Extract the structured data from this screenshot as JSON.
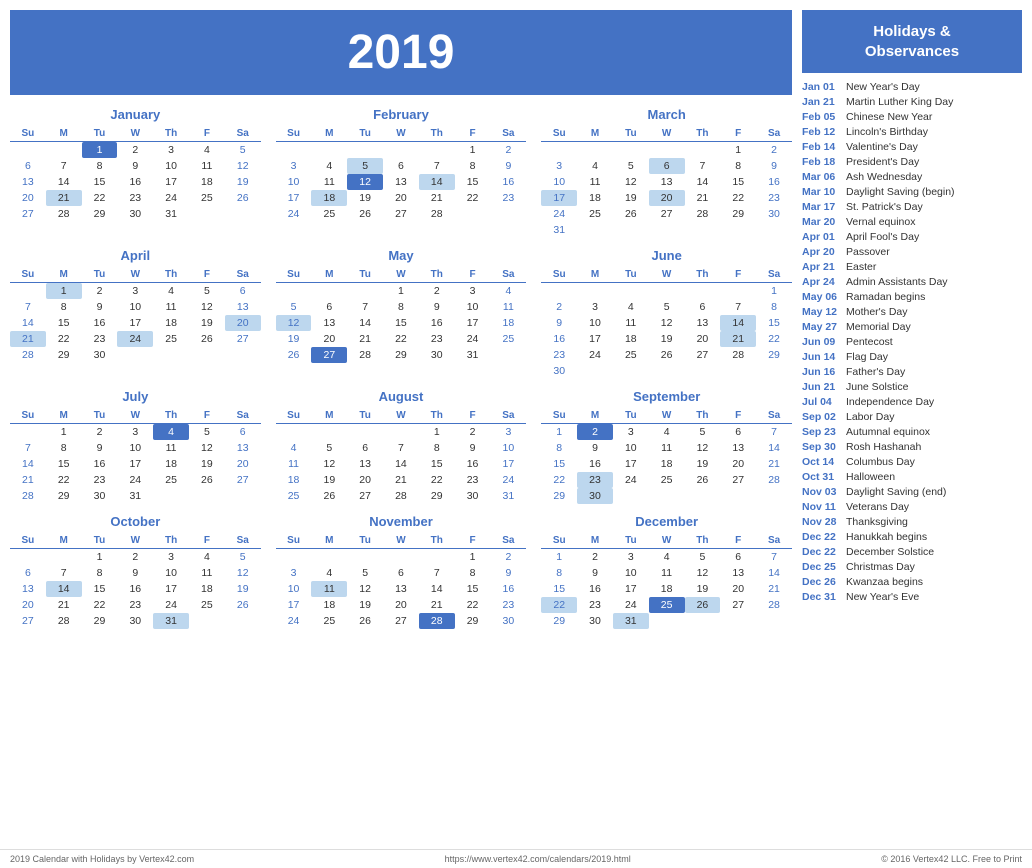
{
  "year": "2019",
  "sidebar": {
    "title": "Holidays &\nObservances",
    "holidays": [
      {
        "date": "Jan 01",
        "name": "New Year's Day"
      },
      {
        "date": "Jan 21",
        "name": "Martin Luther King Day"
      },
      {
        "date": "Feb 05",
        "name": "Chinese New Year"
      },
      {
        "date": "Feb 12",
        "name": "Lincoln's Birthday"
      },
      {
        "date": "Feb 14",
        "name": "Valentine's Day"
      },
      {
        "date": "Feb 18",
        "name": "President's Day"
      },
      {
        "date": "Mar 06",
        "name": "Ash Wednesday"
      },
      {
        "date": "Mar 10",
        "name": "Daylight Saving (begin)"
      },
      {
        "date": "Mar 17",
        "name": "St. Patrick's Day"
      },
      {
        "date": "Mar 20",
        "name": "Vernal equinox"
      },
      {
        "date": "Apr 01",
        "name": "April Fool's Day"
      },
      {
        "date": "Apr 20",
        "name": "Passover"
      },
      {
        "date": "Apr 21",
        "name": "Easter"
      },
      {
        "date": "Apr 24",
        "name": "Admin Assistants Day"
      },
      {
        "date": "May 06",
        "name": "Ramadan begins"
      },
      {
        "date": "May 12",
        "name": "Mother's Day"
      },
      {
        "date": "May 27",
        "name": "Memorial Day"
      },
      {
        "date": "Jun 09",
        "name": "Pentecost"
      },
      {
        "date": "Jun 14",
        "name": "Flag Day"
      },
      {
        "date": "Jun 16",
        "name": "Father's Day"
      },
      {
        "date": "Jun 21",
        "name": "June Solstice"
      },
      {
        "date": "Jul 04",
        "name": "Independence Day"
      },
      {
        "date": "Sep 02",
        "name": "Labor Day"
      },
      {
        "date": "Sep 23",
        "name": "Autumnal equinox"
      },
      {
        "date": "Sep 30",
        "name": "Rosh Hashanah"
      },
      {
        "date": "Oct 14",
        "name": "Columbus Day"
      },
      {
        "date": "Oct 31",
        "name": "Halloween"
      },
      {
        "date": "Nov 03",
        "name": "Daylight Saving (end)"
      },
      {
        "date": "Nov 11",
        "name": "Veterans Day"
      },
      {
        "date": "Nov 28",
        "name": "Thanksgiving"
      },
      {
        "date": "Dec 22",
        "name": "Hanukkah begins"
      },
      {
        "date": "Dec 22",
        "name": "December Solstice"
      },
      {
        "date": "Dec 25",
        "name": "Christmas Day"
      },
      {
        "date": "Dec 26",
        "name": "Kwanzaa begins"
      },
      {
        "date": "Dec 31",
        "name": "New Year's Eve"
      }
    ]
  },
  "footer": {
    "left": "2019 Calendar with Holidays by Vertex42.com",
    "center": "https://www.vertex42.com/calendars/2019.html",
    "right": "© 2016 Vertex42 LLC. Free to Print"
  },
  "months": [
    {
      "name": "January",
      "weeks": [
        [
          "",
          "",
          "1",
          "2",
          "3",
          "4",
          "5"
        ],
        [
          "6",
          "7",
          "8",
          "9",
          "10",
          "11",
          "12"
        ],
        [
          "13",
          "14",
          "15",
          "16",
          "17",
          "18",
          "19"
        ],
        [
          "20",
          "21",
          "22",
          "23",
          "24",
          "25",
          "26"
        ],
        [
          "27",
          "28",
          "29",
          "30",
          "31",
          "",
          ""
        ]
      ],
      "highlights": {
        "1": "holiday",
        "21": "highlight"
      }
    },
    {
      "name": "February",
      "weeks": [
        [
          "",
          "",
          "",
          "",
          "",
          "1",
          "2"
        ],
        [
          "3",
          "4",
          "5",
          "6",
          "7",
          "8",
          "9"
        ],
        [
          "10",
          "11",
          "12",
          "13",
          "14",
          "15",
          "16"
        ],
        [
          "17",
          "18",
          "19",
          "20",
          "21",
          "22",
          "23"
        ],
        [
          "24",
          "25",
          "26",
          "27",
          "28",
          "",
          ""
        ]
      ],
      "highlights": {
        "5": "highlight",
        "12": "holiday",
        "14": "highlight",
        "18": "highlight"
      }
    },
    {
      "name": "March",
      "weeks": [
        [
          "",
          "",
          "",
          "",
          "",
          "1",
          "2"
        ],
        [
          "3",
          "4",
          "5",
          "6",
          "7",
          "8",
          "9"
        ],
        [
          "10",
          "11",
          "12",
          "13",
          "14",
          "15",
          "16"
        ],
        [
          "17",
          "18",
          "19",
          "20",
          "21",
          "22",
          "23"
        ],
        [
          "24",
          "25",
          "26",
          "27",
          "28",
          "29",
          "30"
        ],
        [
          "31",
          "",
          "",
          "",
          "",
          "",
          ""
        ]
      ],
      "highlights": {
        "6": "highlight",
        "17": "highlight",
        "20": "highlight"
      }
    },
    {
      "name": "April",
      "weeks": [
        [
          "",
          "1",
          "2",
          "3",
          "4",
          "5",
          "6"
        ],
        [
          "7",
          "8",
          "9",
          "10",
          "11",
          "12",
          "13"
        ],
        [
          "14",
          "15",
          "16",
          "17",
          "18",
          "19",
          "20"
        ],
        [
          "21",
          "22",
          "23",
          "24",
          "25",
          "26",
          "27"
        ],
        [
          "28",
          "29",
          "30",
          "",
          "",
          "",
          ""
        ]
      ],
      "highlights": {
        "1": "highlight",
        "20": "highlight",
        "21": "highlight",
        "24": "highlight"
      }
    },
    {
      "name": "May",
      "weeks": [
        [
          "",
          "",
          "",
          "1",
          "2",
          "3",
          "4"
        ],
        [
          "5",
          "6",
          "7",
          "8",
          "9",
          "10",
          "11"
        ],
        [
          "12",
          "13",
          "14",
          "15",
          "16",
          "17",
          "18"
        ],
        [
          "19",
          "20",
          "21",
          "22",
          "23",
          "24",
          "25"
        ],
        [
          "26",
          "27",
          "28",
          "29",
          "30",
          "31",
          ""
        ]
      ],
      "highlights": {
        "12": "highlight",
        "27": "holiday"
      }
    },
    {
      "name": "June",
      "weeks": [
        [
          "",
          "",
          "",
          "",
          "",
          "",
          "1"
        ],
        [
          "2",
          "3",
          "4",
          "5",
          "6",
          "7",
          "8"
        ],
        [
          "9",
          "10",
          "11",
          "12",
          "13",
          "14",
          "15"
        ],
        [
          "16",
          "17",
          "18",
          "19",
          "20",
          "21",
          "22"
        ],
        [
          "23",
          "24",
          "25",
          "26",
          "27",
          "28",
          "29"
        ],
        [
          "30",
          "",
          "",
          "",
          "",
          "",
          ""
        ]
      ],
      "highlights": {
        "14": "highlight",
        "21": "highlight"
      }
    },
    {
      "name": "July",
      "weeks": [
        [
          "",
          "1",
          "2",
          "3",
          "4",
          "5",
          "6"
        ],
        [
          "7",
          "8",
          "9",
          "10",
          "11",
          "12",
          "13"
        ],
        [
          "14",
          "15",
          "16",
          "17",
          "18",
          "19",
          "20"
        ],
        [
          "21",
          "22",
          "23",
          "24",
          "25",
          "26",
          "27"
        ],
        [
          "28",
          "29",
          "30",
          "31",
          "",
          "",
          ""
        ]
      ],
      "highlights": {
        "4": "holiday"
      }
    },
    {
      "name": "August",
      "weeks": [
        [
          "",
          "",
          "",
          "",
          "1",
          "2",
          "3"
        ],
        [
          "4",
          "5",
          "6",
          "7",
          "8",
          "9",
          "10"
        ],
        [
          "11",
          "12",
          "13",
          "14",
          "15",
          "16",
          "17"
        ],
        [
          "18",
          "19",
          "20",
          "21",
          "22",
          "23",
          "24"
        ],
        [
          "25",
          "26",
          "27",
          "28",
          "29",
          "30",
          "31"
        ]
      ],
      "highlights": {}
    },
    {
      "name": "September",
      "weeks": [
        [
          "1",
          "2",
          "3",
          "4",
          "5",
          "6",
          "7"
        ],
        [
          "8",
          "9",
          "10",
          "11",
          "12",
          "13",
          "14"
        ],
        [
          "15",
          "16",
          "17",
          "18",
          "19",
          "20",
          "21"
        ],
        [
          "22",
          "23",
          "24",
          "25",
          "26",
          "27",
          "28"
        ],
        [
          "29",
          "30",
          "",
          "",
          "",
          "",
          ""
        ]
      ],
      "highlights": {
        "2": "holiday",
        "23": "highlight",
        "30": "highlight"
      }
    },
    {
      "name": "October",
      "weeks": [
        [
          "",
          "",
          "1",
          "2",
          "3",
          "4",
          "5"
        ],
        [
          "6",
          "7",
          "8",
          "9",
          "10",
          "11",
          "12"
        ],
        [
          "13",
          "14",
          "15",
          "16",
          "17",
          "18",
          "19"
        ],
        [
          "20",
          "21",
          "22",
          "23",
          "24",
          "25",
          "26"
        ],
        [
          "27",
          "28",
          "29",
          "30",
          "31",
          "",
          ""
        ]
      ],
      "highlights": {
        "14": "highlight",
        "31": "highlight"
      }
    },
    {
      "name": "November",
      "weeks": [
        [
          "",
          "",
          "",
          "",
          "",
          "1",
          "2"
        ],
        [
          "3",
          "4",
          "5",
          "6",
          "7",
          "8",
          "9"
        ],
        [
          "10",
          "11",
          "12",
          "13",
          "14",
          "15",
          "16"
        ],
        [
          "17",
          "18",
          "19",
          "20",
          "21",
          "22",
          "23"
        ],
        [
          "24",
          "25",
          "26",
          "27",
          "28",
          "29",
          "30"
        ]
      ],
      "highlights": {
        "11": "highlight",
        "28": "holiday"
      }
    },
    {
      "name": "December",
      "weeks": [
        [
          "1",
          "2",
          "3",
          "4",
          "5",
          "6",
          "7"
        ],
        [
          "8",
          "9",
          "10",
          "11",
          "12",
          "13",
          "14"
        ],
        [
          "15",
          "16",
          "17",
          "18",
          "19",
          "20",
          "21"
        ],
        [
          "22",
          "23",
          "24",
          "25",
          "26",
          "27",
          "28"
        ],
        [
          "29",
          "30",
          "31",
          "",
          "",
          "",
          ""
        ]
      ],
      "highlights": {
        "22": "highlight",
        "25": "holiday",
        "26": "highlight",
        "31": "highlight"
      }
    }
  ]
}
